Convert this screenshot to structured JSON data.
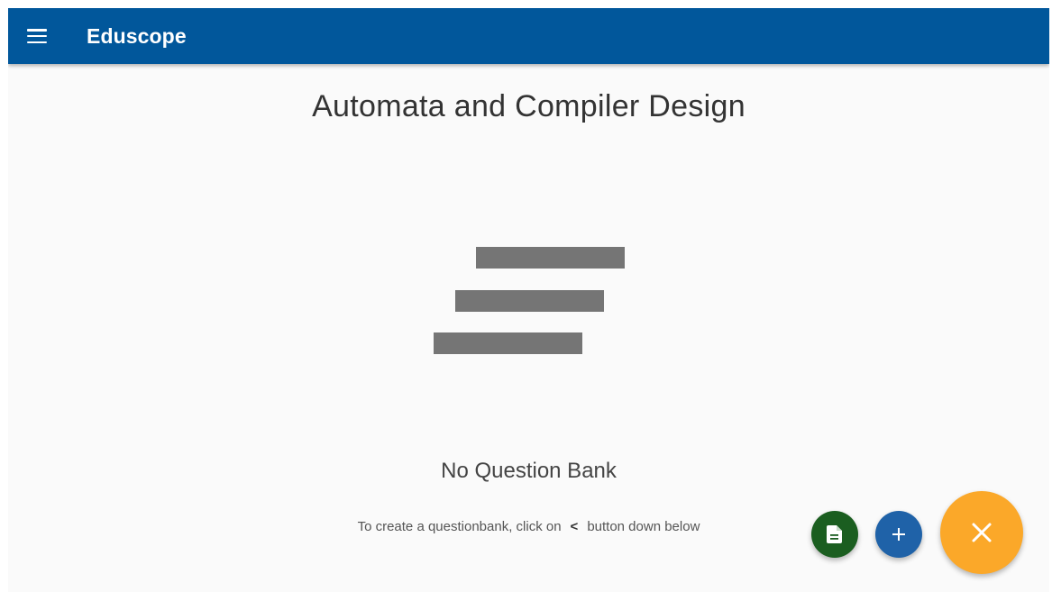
{
  "appbar": {
    "title": "Eduscope",
    "background": "#01579b",
    "menu_icon": "menu-icon"
  },
  "course": {
    "title": "Automata and Compiler Design"
  },
  "empty_state": {
    "illustration_icon": "stacked-lines-icon",
    "illustration_color": "#757575",
    "title": "No Question Bank",
    "hint_before": "To create a questionbank, click on",
    "hint_symbol": "<",
    "hint_after": "button down below"
  },
  "fabs": {
    "document": {
      "icon": "document-icon",
      "color": "#1b5e20"
    },
    "add": {
      "icon": "plus-icon",
      "color": "#1f62a8"
    },
    "close": {
      "icon": "close-icon",
      "color": "#fba829"
    }
  }
}
